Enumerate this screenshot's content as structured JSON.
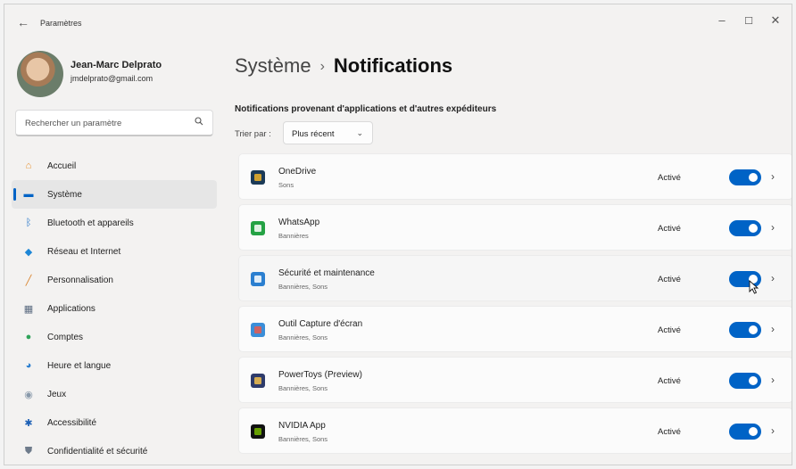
{
  "window": {
    "title": "Paramètres",
    "back_glyph": "←",
    "min_glyph": "–",
    "max_glyph": "☐",
    "close_glyph": "✕"
  },
  "profile": {
    "name": "Jean-Marc Delprato",
    "email": "jmdelprato@gmail.com"
  },
  "search": {
    "placeholder": "Rechercher un paramètre",
    "icon": "search-icon"
  },
  "sidebar": {
    "items": [
      {
        "label": "Accueil",
        "icon": "home-icon",
        "glyph": "⌂",
        "color": "#e8912d"
      },
      {
        "label": "Système",
        "icon": "system-icon",
        "glyph": "▬",
        "color": "#0063c6",
        "selected": true
      },
      {
        "label": "Bluetooth et appareils",
        "icon": "bluetooth-icon",
        "glyph": "ᛒ",
        "color": "#1d70c8"
      },
      {
        "label": "Réseau et Internet",
        "icon": "network-icon",
        "glyph": "◆",
        "color": "#1d86d6"
      },
      {
        "label": "Personnalisation",
        "icon": "brush-icon",
        "glyph": "╱",
        "color": "#d9822b"
      },
      {
        "label": "Applications",
        "icon": "apps-icon",
        "glyph": "▦",
        "color": "#5b6b80"
      },
      {
        "label": "Comptes",
        "icon": "account-icon",
        "glyph": "●",
        "color": "#2fa35a"
      },
      {
        "label": "Heure et langue",
        "icon": "globe-clock-icon",
        "glyph": "◕",
        "color": "#2b7fd0"
      },
      {
        "label": "Jeux",
        "icon": "gamepad-icon",
        "glyph": "◉",
        "color": "#8899aa"
      },
      {
        "label": "Accessibilité",
        "icon": "accessibility-icon",
        "glyph": "✱",
        "color": "#1b5fb5"
      },
      {
        "label": "Confidentialité et sécurité",
        "icon": "shield-icon",
        "glyph": "⛊",
        "color": "#6e7b8b"
      }
    ]
  },
  "breadcrumb": {
    "parent": "Système",
    "separator": "›",
    "current": "Notifications"
  },
  "section": {
    "title": "Notifications provenant d'applications et d'autres expéditeurs",
    "sort_label": "Trier par :",
    "sort_value": "Plus récent",
    "sort_chevron": "⌄"
  },
  "apps": [
    {
      "name": "OneDrive",
      "sub": "Sons",
      "status": "Activé",
      "on": true,
      "icon": "onedrive-icon",
      "color": "#1b3a57",
      "accent": "#f0b429"
    },
    {
      "name": "WhatsApp",
      "sub": "Bannières",
      "status": "Activé",
      "on": true,
      "icon": "whatsapp-icon",
      "color": "#25a244",
      "accent": "#ffffff"
    },
    {
      "name": "Sécurité et maintenance",
      "sub": "Bannières, Sons",
      "status": "Activé",
      "on": true,
      "icon": "security-maintenance-icon",
      "color": "#2b7fd0",
      "accent": "#ffffff"
    },
    {
      "name": "Outil Capture d'écran",
      "sub": "Bannières, Sons",
      "status": "Activé",
      "on": true,
      "icon": "snipping-tool-icon",
      "color": "#3b8ed8",
      "accent": "#e85a4f"
    },
    {
      "name": "PowerToys (Preview)",
      "sub": "Bannières, Sons",
      "status": "Activé",
      "on": true,
      "icon": "powertoys-icon",
      "color": "#2e3b6b",
      "accent": "#f2c14e"
    },
    {
      "name": "NVIDIA App",
      "sub": "Bannières, Sons",
      "status": "Activé",
      "on": true,
      "icon": "nvidia-icon",
      "color": "#111111",
      "accent": "#76b900"
    }
  ],
  "row_chevron": "›"
}
